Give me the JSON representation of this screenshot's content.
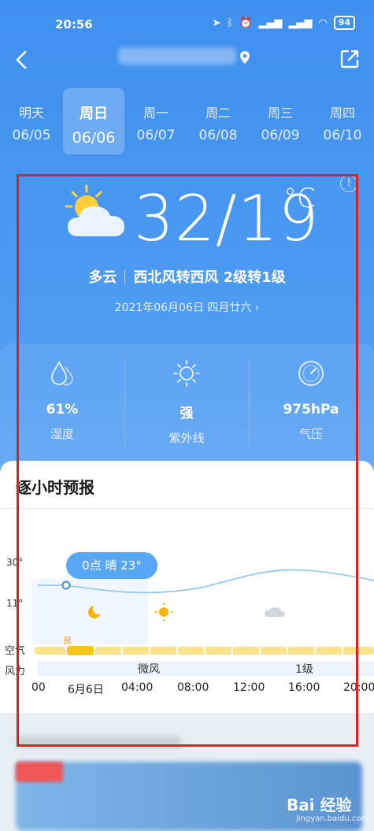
{
  "status_bar": {
    "time": "20:56",
    "battery": "94"
  },
  "header": {
    "location_pin": "location-pin-icon"
  },
  "days": [
    {
      "name": "明天",
      "date": "06/05"
    },
    {
      "name": "周日",
      "date": "06/06",
      "active": true
    },
    {
      "name": "周一",
      "date": "06/07"
    },
    {
      "name": "周二",
      "date": "06/08"
    },
    {
      "name": "周三",
      "date": "06/09"
    },
    {
      "name": "周四",
      "date": "06/10"
    }
  ],
  "current": {
    "temp": "32/19",
    "unit": "°C",
    "condition": "多云",
    "wind": "西北风转西风 2级转1级",
    "date_line": "2021年06月06日 四月廿六 ›",
    "info": "!"
  },
  "stats": [
    {
      "value": "61%",
      "label": "湿度",
      "icon": "humidity-icon"
    },
    {
      "value": "强",
      "label": "紫外线",
      "icon": "sun-uv-icon"
    },
    {
      "value": "975hPa",
      "label": "气压",
      "icon": "pressure-gauge-icon"
    }
  ],
  "hourly": {
    "title": "逐小时预报",
    "y_labels": [
      "30°",
      "11°"
    ],
    "tooltip": "0点 晴 23°",
    "air_label": "空气",
    "wind_label": "风力",
    "air_quality_tag": "良",
    "wind_segments": [
      "微风",
      "1级"
    ],
    "times": [
      "00",
      "6月6日",
      "04:00",
      "08:00",
      "12:00",
      "16:00",
      "20:00"
    ]
  },
  "watermark": {
    "text": "Bai 经验",
    "sub": "jingyan.baidu.com"
  }
}
